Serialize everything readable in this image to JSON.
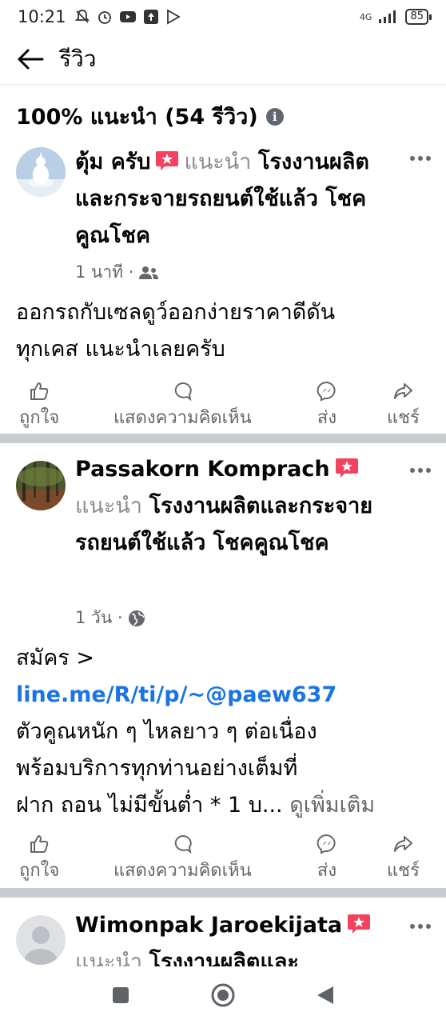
{
  "status_bar": {
    "time": "10:21",
    "network": "4G",
    "battery": "85"
  },
  "header": {
    "title": "รีวิว"
  },
  "summary": {
    "text": "100% แนะนำ (54 รีวิว)"
  },
  "posts": [
    {
      "author": "ตุ้ม ครับ",
      "recommend": "แนะนำ",
      "page": "โรงงานผลิตและกระจายรถยนต์ใช้แล้ว โชคคูณโชค",
      "time": "1 นาที ·",
      "privacy_icon": "friends-icon",
      "lines": [
        "ออกรถกับเซลดูว์ออกง่ายราคาดีดัน",
        "ทุกเคส แนะนำเลยครับ"
      ]
    },
    {
      "author": "Passakorn Komprach",
      "recommend": "แนะนำ",
      "page": "โรงงานผลิตและกระจายรถยนต์ใช้แล้ว โชคคูณโชค",
      "time": "1 วัน ·",
      "privacy_icon": "globe-icon",
      "lines": [
        "สมัคร >",
        "line.me/R/ti/p/~@paew637",
        "ตัวคูณหนัก ๆ ไหลยาว ๆ ต่อเนื่อง",
        "พร้อมบริการทุกท่านอย่างเต็มที่",
        "ฝาก ถอน ไม่มีขั้นต่ำ * 1 บ..."
      ],
      "see_more": "ดูเพิ่มเติม"
    },
    {
      "author": "Wimonpak Jaroekijata",
      "recommend": "แนะนำ",
      "page": "โรงงานผลิตและ"
    }
  ],
  "actions": {
    "like": "ถูกใจ",
    "comment": "แสดงความคิดเห็น",
    "send": "ส่ง",
    "share": "แชร์"
  },
  "colors": {
    "link": "#1b74e4",
    "badge": "#f3425f",
    "muted": "#65676b",
    "separator": "#c9ccd1"
  }
}
